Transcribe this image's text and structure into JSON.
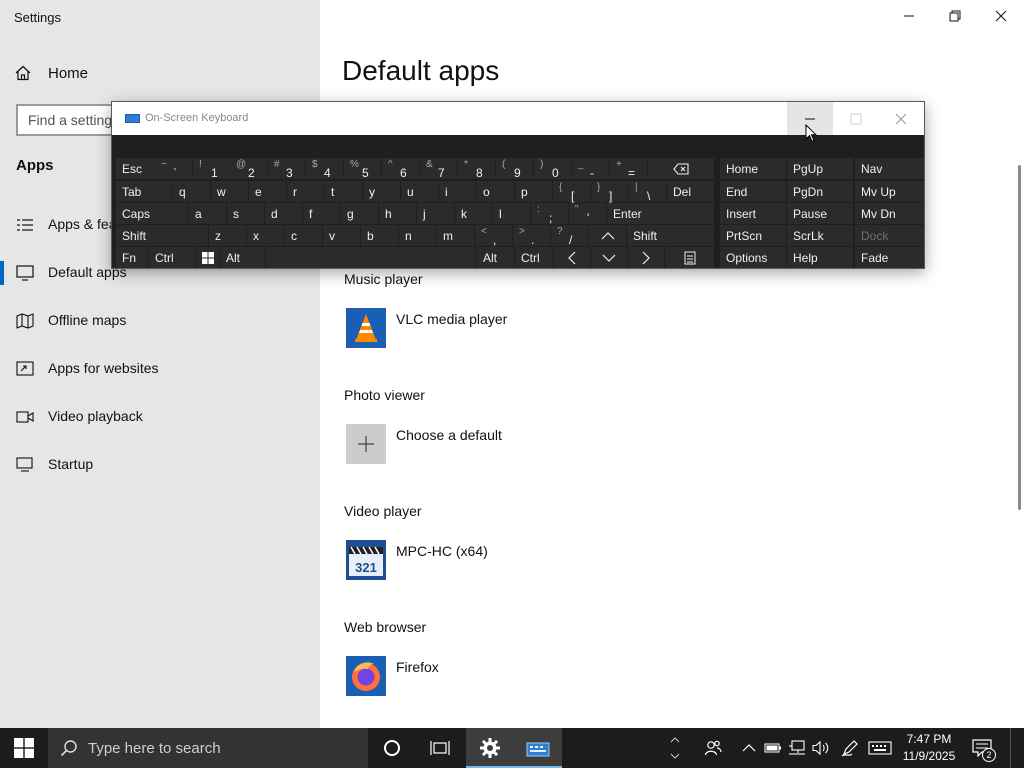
{
  "window": {
    "title": "Settings"
  },
  "sidebar": {
    "home_label": "Home",
    "search_placeholder": "Find a setting",
    "section": "Apps",
    "items": [
      {
        "label": "Apps & features",
        "icon": "list-icon"
      },
      {
        "label": "Default apps",
        "icon": "default-apps-icon",
        "active": true
      },
      {
        "label": "Offline maps",
        "icon": "map-icon"
      },
      {
        "label": "Apps for websites",
        "icon": "link-window-icon"
      },
      {
        "label": "Video playback",
        "icon": "video-icon"
      },
      {
        "label": "Startup",
        "icon": "startup-icon"
      }
    ]
  },
  "main": {
    "title": "Default apps",
    "categories": [
      {
        "label": "Music player",
        "app": "VLC media player",
        "icon": "vlc-icon"
      },
      {
        "label": "Photo viewer",
        "app": "Choose a default",
        "icon": "plus-icon"
      },
      {
        "label": "Video player",
        "app": "MPC-HC (x64)",
        "icon": "mpc-hc-icon"
      },
      {
        "label": "Web browser",
        "app": "Firefox",
        "icon": "firefox-icon"
      }
    ]
  },
  "osk": {
    "title": "On-Screen Keyboard",
    "row1": [
      {
        "m": "Esc"
      },
      {
        "s": "~",
        "b": "`"
      },
      {
        "s": "!",
        "b": "1"
      },
      {
        "s": "@",
        "b": "2"
      },
      {
        "s": "#",
        "b": "3"
      },
      {
        "s": "$",
        "b": "4"
      },
      {
        "s": "%",
        "b": "5"
      },
      {
        "s": "^",
        "b": "6"
      },
      {
        "s": "&",
        "b": "7"
      },
      {
        "s": "*",
        "b": "8"
      },
      {
        "s": "(",
        "b": "9"
      },
      {
        "s": ")",
        "b": "0"
      },
      {
        "s": "_",
        "b": "-"
      },
      {
        "s": "+",
        "b": "="
      },
      {
        "icon": "backspace-icon"
      }
    ],
    "row2": [
      {
        "m": "Tab"
      },
      {
        "m": "q"
      },
      {
        "m": "w"
      },
      {
        "m": "e"
      },
      {
        "m": "r"
      },
      {
        "m": "t"
      },
      {
        "m": "y"
      },
      {
        "m": "u"
      },
      {
        "m": "i"
      },
      {
        "m": "o"
      },
      {
        "m": "p"
      },
      {
        "s": "{",
        "b": "["
      },
      {
        "s": "}",
        "b": "]"
      },
      {
        "s": "|",
        "b": "\\"
      },
      {
        "m": "Del"
      }
    ],
    "row3": [
      {
        "m": "Caps"
      },
      {
        "m": "a"
      },
      {
        "m": "s"
      },
      {
        "m": "d"
      },
      {
        "m": "f"
      },
      {
        "m": "g"
      },
      {
        "m": "h"
      },
      {
        "m": "j"
      },
      {
        "m": "k"
      },
      {
        "m": "l"
      },
      {
        "s": ":",
        "b": ";"
      },
      {
        "s": "\"",
        "b": "'"
      },
      {
        "m": "Enter"
      }
    ],
    "row4": [
      {
        "m": "Shift"
      },
      {
        "m": "z"
      },
      {
        "m": "x"
      },
      {
        "m": "c"
      },
      {
        "m": "v"
      },
      {
        "m": "b"
      },
      {
        "m": "n"
      },
      {
        "m": "m"
      },
      {
        "s": "<",
        "b": ","
      },
      {
        "s": ">",
        "b": "."
      },
      {
        "s": "?",
        "b": "/"
      },
      {
        "icon": "arrow-up-icon"
      },
      {
        "m": "Shift"
      }
    ],
    "row5": [
      {
        "m": "Fn"
      },
      {
        "m": "Ctrl"
      },
      {
        "icon": "windows-key-icon"
      },
      {
        "m": "Alt"
      },
      {
        "m": ""
      },
      {
        "m": "Alt"
      },
      {
        "m": "Ctrl"
      },
      {
        "icon": "arrow-left-icon"
      },
      {
        "icon": "arrow-down-icon"
      },
      {
        "icon": "arrow-right-icon"
      },
      {
        "icon": "menu-key-icon"
      }
    ],
    "nav": [
      [
        "Home",
        "PgUp",
        "Nav"
      ],
      [
        "End",
        "PgDn",
        "Mv Up"
      ],
      [
        "Insert",
        "Pause",
        "Mv Dn"
      ],
      [
        "PrtScn",
        "ScrLk",
        "Dock"
      ],
      [
        "Options",
        "Help",
        "Fade"
      ]
    ]
  },
  "taskbar": {
    "search_placeholder": "Type here to search",
    "time": "7:47 PM",
    "date": "11/9/2025",
    "notification_count": "2"
  }
}
